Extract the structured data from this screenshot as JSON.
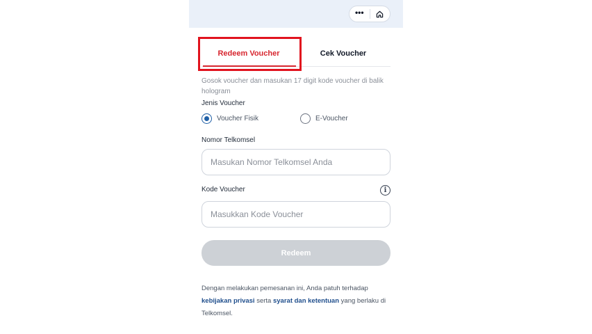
{
  "header": {
    "more_icon": "more-horizontal-icon",
    "home_icon": "home-icon"
  },
  "tabs": [
    {
      "label": "Redeem Voucher",
      "active": true
    },
    {
      "label": "Cek Voucher",
      "active": false
    }
  ],
  "form": {
    "instruction": "Gosok voucher dan masukan 17 digit kode voucher di balik hologram",
    "jenis_label": "Jenis Voucher",
    "options": [
      {
        "label": "Voucher Fisik",
        "selected": true
      },
      {
        "label": "E-Voucher",
        "selected": false
      }
    ],
    "nomor_label": "Nomor Telkomsel",
    "nomor_placeholder": "Masukan Nomor Telkomsel Anda",
    "kode_label": "Kode Voucher",
    "kode_placeholder": "Masukkan Kode Voucher",
    "info_glyph": "i",
    "redeem_label": "Redeem"
  },
  "footer": {
    "text_1": "Dengan melakukan pemesanan ini, Anda patuh terhadap",
    "privacy_link": "kebijakan privasi",
    "text_2": " serta ",
    "terms_link": "syarat dan ketentuan",
    "text_3": " yang berlaku di Telkomsel."
  },
  "colors": {
    "accent_red": "#d7262f",
    "link_blue": "#1f4e8c",
    "radio_blue": "#1f5fa6",
    "disabled_button": "#cdd1d6",
    "topbar_bg": "#eaf0f9"
  }
}
